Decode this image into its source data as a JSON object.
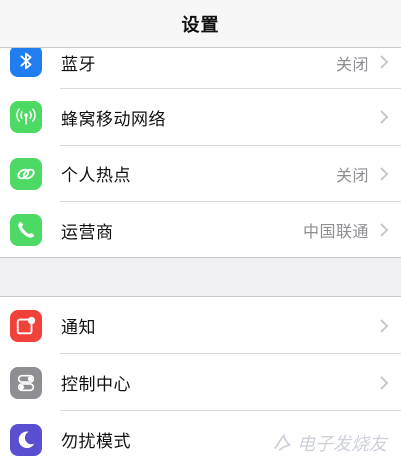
{
  "header": {
    "title": "设置"
  },
  "group1": {
    "bluetooth": {
      "label": "蓝牙",
      "value": "关闭",
      "icon": "bluetooth-icon",
      "color": "#1f7df0"
    },
    "cellular": {
      "label": "蜂窝移动网络",
      "icon": "cellular-antenna-icon",
      "color": "#4cd964"
    },
    "hotspot": {
      "label": "个人热点",
      "value": "关闭",
      "icon": "hotspot-link-icon",
      "color": "#4cd964"
    },
    "carrier": {
      "label": "运营商",
      "value": "中国联通",
      "icon": "phone-icon",
      "color": "#4cd964"
    }
  },
  "group2": {
    "notifications": {
      "label": "通知",
      "icon": "notifications-icon",
      "color": "#f0413a"
    },
    "control_center": {
      "label": "控制中心",
      "icon": "control-center-icon",
      "color": "#8e8e93"
    },
    "do_not_disturb": {
      "label": "勿扰模式",
      "icon": "moon-icon",
      "color": "#5a4fd1"
    }
  },
  "watermark": {
    "text": "电子发烧友"
  }
}
